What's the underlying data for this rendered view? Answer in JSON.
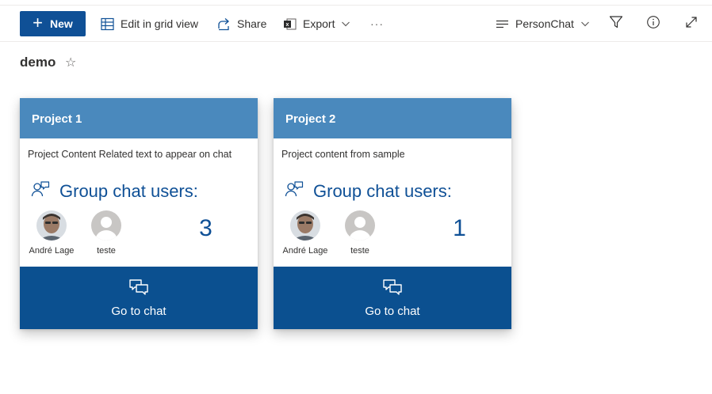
{
  "toolbar": {
    "new_label": "New",
    "edit_grid_label": "Edit in grid view",
    "share_label": "Share",
    "export_label": "Export",
    "more_label": "···",
    "view_label": "PersonChat"
  },
  "page": {
    "title": "demo"
  },
  "cards": [
    {
      "title": "Project 1",
      "description": "Project Content Related text to appear on chat",
      "group_label": "Group chat users:",
      "users": [
        {
          "name": "André Lage",
          "avatar": "photo"
        },
        {
          "name": "teste",
          "avatar": "placeholder"
        }
      ],
      "count": "3",
      "footer_label": "Go to chat"
    },
    {
      "title": "Project 2",
      "description": "Project content from sample",
      "group_label": "Group chat users:",
      "users": [
        {
          "name": "André Lage",
          "avatar": "photo"
        },
        {
          "name": "teste",
          "avatar": "placeholder"
        }
      ],
      "count": "1",
      "footer_label": "Go to chat"
    }
  ],
  "icons": {
    "new": "plus-icon",
    "edit_grid": "grid-icon",
    "share": "share-icon",
    "export": "excel-icon",
    "view": "view-lines-icon",
    "filter": "filter-icon",
    "info": "info-icon",
    "expand": "expand-icon",
    "favorite": "star-icon",
    "group": "group-chat-icon",
    "go_to_chat": "chat-bubbles-icon"
  },
  "colors": {
    "brand": "#0f5096",
    "card_header": "#4a89bd",
    "card_footer": "#0b5090"
  }
}
